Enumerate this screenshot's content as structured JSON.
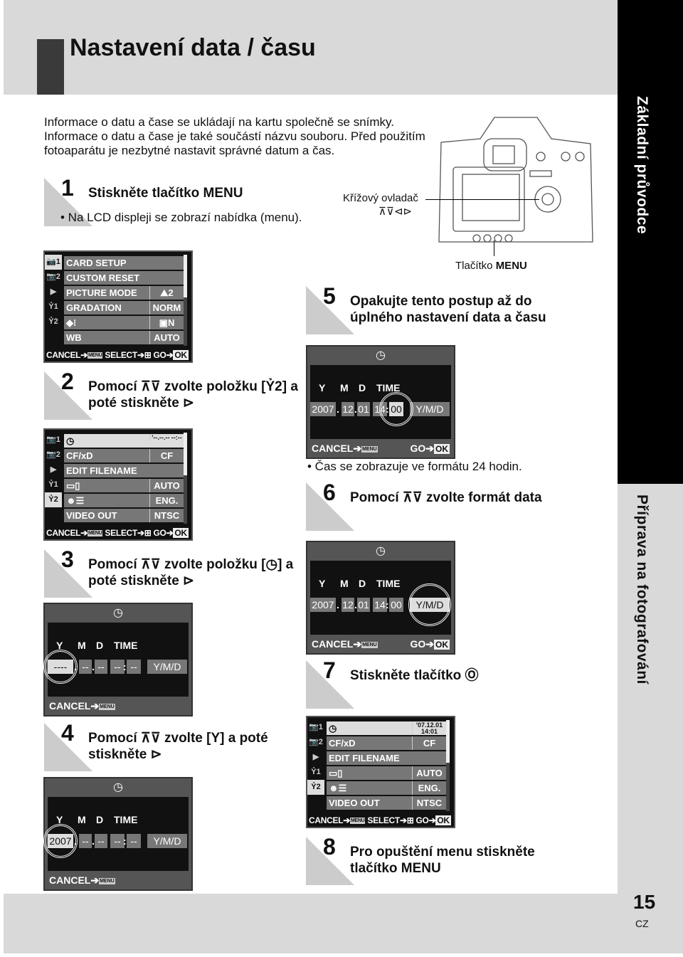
{
  "page": {
    "title": "Nastavení data / času",
    "section_top": "Základní průvodce",
    "section_bottom": "Příprava na fotografování",
    "page_number": "15",
    "language": "CZ"
  },
  "intro": "Informace o datu a čase se ukládají na kartu společně se snímky. Informace o datu a čase je také součástí názvu souboru. Před použitím fotoaparátu je nezbytné nastavit správné datum a čas.",
  "camera": {
    "cross_pad_label": "Křížový ovladač",
    "cross_pad_icons": "⊼⊽⊲⊳",
    "menu_button_label": "Tlačítko",
    "menu_button_bold": "MENU"
  },
  "steps": [
    {
      "num": "1",
      "text": "Stiskněte tlačítko MENU",
      "bullet": "• Na LCD displeji se zobrazí nabídka (menu)."
    },
    {
      "num": "2",
      "text": "Pomocí ⊼⊽ zvolte položku [Ỷ2] a poté stiskněte ⊳"
    },
    {
      "num": "3",
      "text": "Pomocí ⊼⊽ zvolte položku [◷] a poté stiskněte ⊳"
    },
    {
      "num": "4",
      "text": "Pomocí ⊼⊽ zvolte [Y] a poté stiskněte ⊳"
    },
    {
      "num": "5",
      "text": "Opakujte tento postup až do úplného nastavení data a času",
      "bullet": "• Čas se zobrazuje ve formátu 24 hodin."
    },
    {
      "num": "6",
      "text": "Pomocí ⊼⊽ zvolte formát data"
    },
    {
      "num": "7",
      "text": "Stiskněte tlačítko Ⓞ"
    },
    {
      "num": "8",
      "text": "Pro opuštění menu stiskněte tlačítko MENU"
    }
  ],
  "menus": [
    {
      "tabs": [
        "📷1",
        "📷2",
        "▶",
        "Ỷ1",
        "Ỷ2"
      ],
      "selected_tab": 0,
      "highlight": -1,
      "rows": [
        {
          "label": "CARD SETUP",
          "value": ""
        },
        {
          "label": "CUSTOM RESET",
          "value": ""
        },
        {
          "label": "PICTURE MODE",
          "value": "⛰2"
        },
        {
          "label": "GRADATION",
          "value": "NORM"
        },
        {
          "label": "◆⁝",
          "value": "▣N"
        },
        {
          "label": "WB",
          "value": "AUTO"
        }
      ],
      "footer": "CANCEL➔",
      "footer_select": " SELECT➔⊞ ",
      "footer_go": "GO➔",
      "ok": "OK",
      "menu_icon": "MENU"
    },
    {
      "tabs": [
        "📷1",
        "📷2",
        "▶",
        "Ỷ1",
        "Ỷ2"
      ],
      "selected_tab": 4,
      "highlight": 0,
      "rows": [
        {
          "label": "◷",
          "value": "'--.--.-- --:--"
        },
        {
          "label": "CF/xD",
          "value": "CF"
        },
        {
          "label": "EDIT FILENAME",
          "value": ""
        },
        {
          "label": "▭▯",
          "value": "AUTO"
        },
        {
          "label": "☻☰",
          "value": "ENG."
        },
        {
          "label": "VIDEO OUT",
          "value": "NTSC"
        }
      ],
      "footer": "CANCEL➔",
      "footer_select": " SELECT➔⊞ ",
      "footer_go": "GO➔",
      "ok": "OK",
      "menu_icon": "MENU"
    },
    {
      "tabs": [
        "📷1",
        "📷2",
        "▶",
        "Ỷ1",
        "Ỷ2"
      ],
      "selected_tab": 4,
      "highlight": 0,
      "rows": [
        {
          "label": "◷",
          "value": "'07.12.01 14:01"
        },
        {
          "label": "CF/xD",
          "value": "CF"
        },
        {
          "label": "EDIT FILENAME",
          "value": ""
        },
        {
          "label": "▭▯",
          "value": "AUTO"
        },
        {
          "label": "☻☰",
          "value": "ENG."
        },
        {
          "label": "VIDEO OUT",
          "value": "NTSC"
        }
      ],
      "footer": "CANCEL➔",
      "footer_select": " SELECT➔⊞ ",
      "footer_go": "GO➔",
      "ok": "OK",
      "menu_icon": "MENU"
    }
  ],
  "date_screens": [
    {
      "labels": [
        "Y",
        "M",
        "D",
        "TIME"
      ],
      "values": [
        "----",
        "--",
        "--",
        "--",
        "--"
      ],
      "format": "Y/M/D",
      "selected": 0,
      "cancel": "CANCEL➔",
      "menu_icon": "MENU",
      "go": ""
    },
    {
      "labels": [
        "Y",
        "M",
        "D",
        "TIME"
      ],
      "values": [
        "2007",
        "--",
        "--",
        "--",
        "--"
      ],
      "format": "Y/M/D",
      "selected": 0,
      "cancel": "CANCEL➔",
      "menu_icon": "MENU",
      "go": ""
    },
    {
      "labels": [
        "Y",
        "M",
        "D",
        "TIME"
      ],
      "values": [
        "2007",
        "12",
        "01",
        "14",
        "00"
      ],
      "format": "Y/M/D",
      "selected": 4,
      "cancel": "CANCEL➔",
      "menu_icon": "MENU",
      "go": "GO➔",
      "ok": "OK"
    },
    {
      "labels": [
        "Y",
        "M",
        "D",
        "TIME"
      ],
      "values": [
        "2007",
        "12",
        "01",
        "14",
        "00"
      ],
      "format": "Y/M/D",
      "selected": 5,
      "cancel": "CANCEL➔",
      "menu_icon": "MENU",
      "go": "GO➔",
      "ok": "OK"
    }
  ]
}
